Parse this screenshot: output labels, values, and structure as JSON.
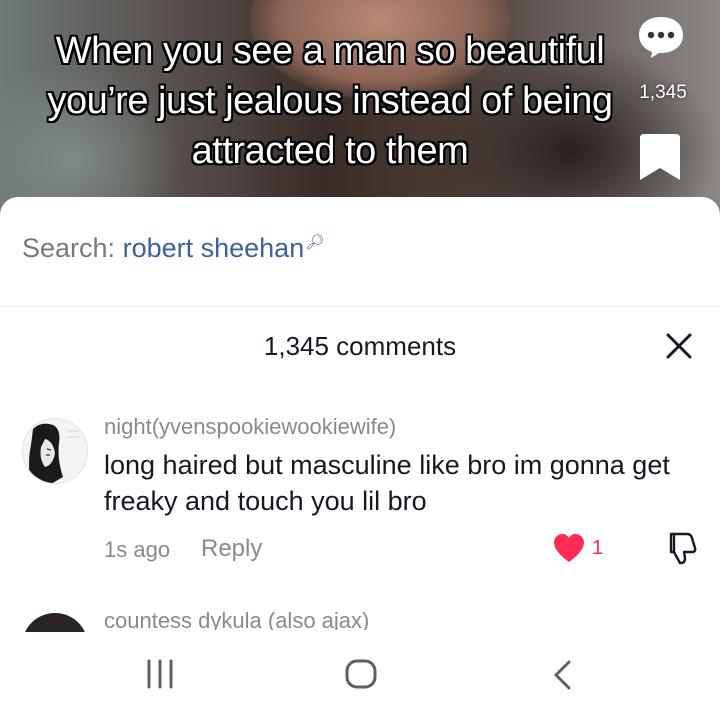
{
  "video": {
    "caption": "When you see a man so beautiful you’re just jealous instead of being attracted to them",
    "comment_count": "1,345"
  },
  "search": {
    "label": "Search:",
    "term": "robert sheehan",
    "icon": "search-icon"
  },
  "comments_panel": {
    "title": "1,345 comments",
    "close_icon": "close-icon"
  },
  "comments": [
    {
      "username": "night(yvenspookiewookiewife)",
      "text": "long haired but masculine like bro im gonna get freaky and touch you lil bro",
      "time": "1s ago",
      "reply_label": "Reply",
      "likes": "1",
      "liked": true
    },
    {
      "username": "countess dykula (also ajax)"
    }
  ],
  "navbar": {
    "recent_icon": "recent-apps-icon",
    "home_icon": "home-icon",
    "back_icon": "back-icon"
  },
  "colors": {
    "accent_blue": "#3d62a0",
    "like_red": "#fe2c55",
    "muted_gray": "#8a8a8a",
    "text_dark": "#161823"
  }
}
